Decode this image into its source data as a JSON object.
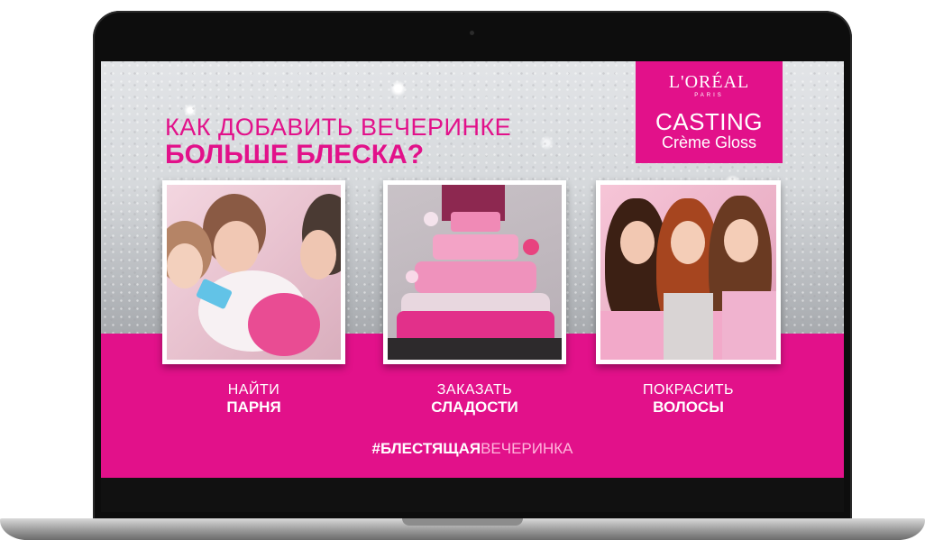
{
  "brand": {
    "loreal": "L'ORÉAL",
    "paris": "PARIS",
    "casting": "CASTING",
    "creme": "Crème Gloss"
  },
  "headline": {
    "line1": "КАК ДОБАВИТЬ ВЕЧЕРИНКЕ",
    "line2": "БОЛЬШЕ БЛЕСКА?"
  },
  "cards": [
    {
      "line1": "НАЙТИ",
      "line2": "ПАРНЯ"
    },
    {
      "line1": "ЗАКАЗАТЬ",
      "line2": "СЛАДОСТИ"
    },
    {
      "line1": "ПОКРАСИТЬ",
      "line2": "ВОЛОСЫ"
    }
  ],
  "hashtag": {
    "hash": "#",
    "bold": "БЛЕСТЯЩАЯ",
    "light": "ВЕЧЕРИНКА"
  },
  "colors": {
    "accent": "#e2118a"
  }
}
